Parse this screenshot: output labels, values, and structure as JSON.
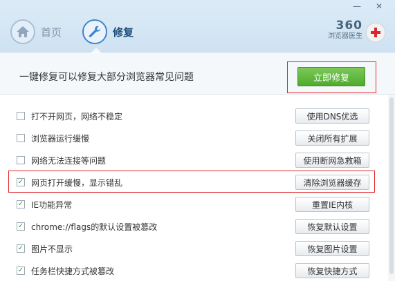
{
  "window": {
    "minimize_glyph": "—",
    "close_glyph": "✕"
  },
  "nav": {
    "home_label": "首页",
    "repair_label": "修复",
    "home_icon": "home-icon",
    "repair_icon": "wrench-icon"
  },
  "brand": {
    "number": "360",
    "name": "浏览器医生"
  },
  "header": {
    "headline": "一键修复可以修复大部分浏览器常见问题",
    "fix_button": "立即修复"
  },
  "colors": {
    "accent_blue": "#3f86c8",
    "fix_green": "#4faa2e",
    "highlight_red": "#e0262a",
    "check_green": "#2f9a2f"
  },
  "items": [
    {
      "label": "打不开网页，网络不稳定",
      "checked": false,
      "button": "使用DNS优选"
    },
    {
      "label": "浏览器运行缓慢",
      "checked": false,
      "button": "关闭所有扩展"
    },
    {
      "label": "网络无法连接等问题",
      "checked": false,
      "button": "使用断网急救箱"
    },
    {
      "label": "网页打开缓慢，显示错乱",
      "checked": true,
      "button": "清除浏览器缓存"
    },
    {
      "label": "IE功能异常",
      "checked": true,
      "button": "重置IE内核"
    },
    {
      "label": "chrome://flags的默认设置被篡改",
      "checked": true,
      "button": "恢复默认设置"
    },
    {
      "label": "图片不显示",
      "checked": true,
      "button": "恢复图片设置"
    },
    {
      "label": "任务栏快捷方式被篡改",
      "checked": true,
      "button": "恢复快捷方式"
    }
  ]
}
